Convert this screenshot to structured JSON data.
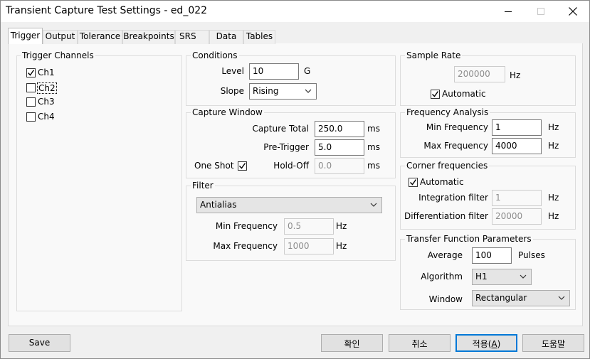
{
  "window": {
    "title": "Transient Capture Test Settings - ed_022"
  },
  "tabs": [
    "Trigger",
    "Output",
    "Tolerance",
    "Breakpoints",
    "SRS",
    "Data",
    "Tables"
  ],
  "trigger_channels": {
    "title": "Trigger Channels",
    "channels": [
      {
        "label": "Ch1",
        "checked": true
      },
      {
        "label": "Ch2",
        "checked": false
      },
      {
        "label": "Ch3",
        "checked": false
      },
      {
        "label": "Ch4",
        "checked": false
      }
    ]
  },
  "conditions": {
    "title": "Conditions",
    "level_label": "Level",
    "level_value": "10",
    "level_unit": "G",
    "slope_label": "Slope",
    "slope_value": "Rising"
  },
  "capture_window": {
    "title": "Capture Window",
    "capture_total_label": "Capture Total",
    "capture_total_value": "250.0",
    "capture_total_unit": "ms",
    "pre_trigger_label": "Pre-Trigger",
    "pre_trigger_value": "5.0",
    "pre_trigger_unit": "ms",
    "one_shot_label": "One Shot",
    "one_shot_checked": true,
    "hold_off_label": "Hold-Off",
    "hold_off_value": "0.0",
    "hold_off_unit": "ms"
  },
  "filter": {
    "title": "Filter",
    "type_value": "Antialias",
    "min_label": "Min Frequency",
    "min_value": "0.5",
    "min_unit": "Hz",
    "max_label": "Max Frequency",
    "max_value": "1000",
    "max_unit": "Hz"
  },
  "sample_rate": {
    "title": "Sample Rate",
    "value": "200000",
    "unit": "Hz",
    "automatic_label": "Automatic",
    "automatic_checked": true
  },
  "frequency_analysis": {
    "title": "Frequency Analysis",
    "min_label": "Min Frequency",
    "min_value": "1",
    "min_unit": "Hz",
    "max_label": "Max Frequency",
    "max_value": "4000",
    "max_unit": "Hz"
  },
  "corner_frequencies": {
    "title": "Corner frequencies",
    "automatic_label": "Automatic",
    "automatic_checked": true,
    "integration_label": "Integration filter",
    "integration_value": "1",
    "integration_unit": "Hz",
    "differentiation_label": "Differentiation filter",
    "differentiation_value": "20000",
    "differentiation_unit": "Hz"
  },
  "transfer_function": {
    "title": "Transfer Function Parameters",
    "average_label": "Average",
    "average_value": "100",
    "average_unit": "Pulses",
    "algorithm_label": "Algorithm",
    "algorithm_value": "H1",
    "window_label": "Window",
    "window_value": "Rectangular"
  },
  "buttons": {
    "save": "Save",
    "ok": "확인",
    "cancel": "취소",
    "apply_prefix": "적용(",
    "apply_key": "A",
    "apply_suffix": ")",
    "help": "도움말"
  }
}
